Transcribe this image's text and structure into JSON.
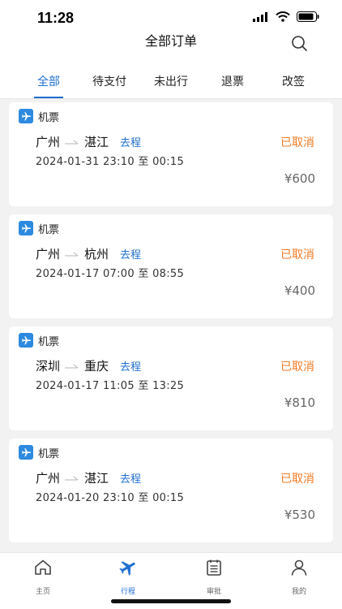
{
  "status_bar": {
    "time": "11:28"
  },
  "nav": {
    "title": "全部订单",
    "search_icon": "search-icon"
  },
  "tabs": [
    {
      "label": "全部",
      "active": true
    },
    {
      "label": "待支付",
      "active": false
    },
    {
      "label": "未出行",
      "active": false
    },
    {
      "label": "退票",
      "active": false
    },
    {
      "label": "改签",
      "active": false
    }
  ],
  "orders": [
    {
      "type_label": "机票",
      "from": "广州",
      "to": "湛江",
      "trip_tag": "去程",
      "status": "已取消",
      "time": "2024-01-31 23:10 至 00:15",
      "price": "¥600"
    },
    {
      "type_label": "机票",
      "from": "广州",
      "to": "杭州",
      "trip_tag": "去程",
      "status": "已取消",
      "time": "2024-01-17 07:00 至 08:55",
      "price": "¥400"
    },
    {
      "type_label": "机票",
      "from": "深圳",
      "to": "重庆",
      "trip_tag": "去程",
      "status": "已取消",
      "time": "2024-01-17 11:05 至 13:25",
      "price": "¥810"
    },
    {
      "type_label": "机票",
      "from": "广州",
      "to": "湛江",
      "trip_tag": "去程",
      "status": "已取消",
      "time": "2024-01-20 23:10 至 00:15",
      "price": "¥530"
    }
  ],
  "tab_bar": [
    {
      "label": "主页",
      "icon": "home-icon",
      "active": false
    },
    {
      "label": "行程",
      "icon": "plane-icon",
      "active": true
    },
    {
      "label": "审批",
      "icon": "approval-icon",
      "active": false
    },
    {
      "label": "我的",
      "icon": "user-icon",
      "active": false
    }
  ],
  "colors": {
    "accent": "#1f6fd1",
    "status_cancelled": "#f07a22",
    "plane_icon_bg": "#2d8ae0"
  }
}
